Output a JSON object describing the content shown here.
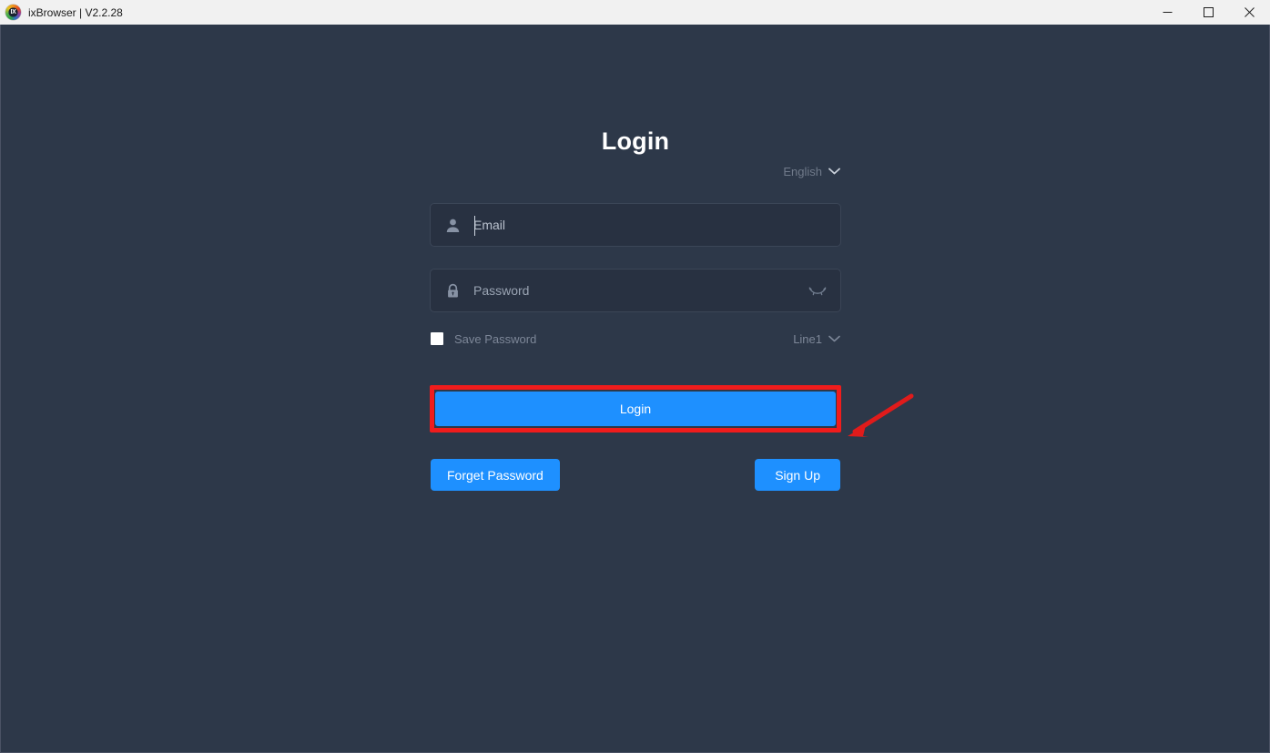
{
  "titlebar": {
    "logo_icon": "ixbrowser-logo-icon",
    "title": "ixBrowser | V2.2.28",
    "minimize_label": "Minimize",
    "maximize_label": "Maximize",
    "close_label": "Close"
  },
  "login": {
    "heading": "Login",
    "language": {
      "value": "English",
      "icon": "chevron-down-icon"
    },
    "email_field": {
      "icon": "user-icon",
      "placeholder": "Email",
      "value": ""
    },
    "password_field": {
      "icon": "lock-icon",
      "placeholder": "Password",
      "value": "",
      "toggle_icon": "eye-off-icon"
    },
    "save_password": {
      "label": "Save Password",
      "checked": false
    },
    "line": {
      "value": "Line1",
      "icon": "chevron-down-icon"
    },
    "login_button": "Login",
    "forget_password_button": "Forget Password",
    "sign_up_button": "Sign Up"
  },
  "annotations": {
    "highlight_color": "#f01c1c",
    "arrow_color": "#e01b1b",
    "target": "login-button"
  },
  "colors": {
    "background": "#2d3849",
    "input_background": "#283141",
    "accent_blue": "#1e90ff",
    "titlebar": "#f1f1f1"
  }
}
